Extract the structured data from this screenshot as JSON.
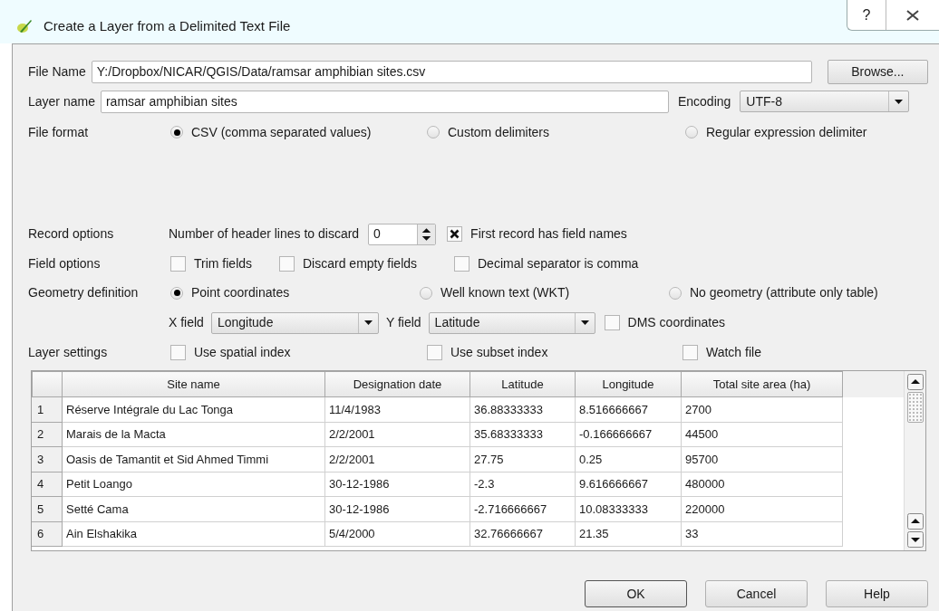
{
  "window": {
    "title": "Create a Layer from a Delimited Text File",
    "help_button": "?"
  },
  "file_name": {
    "label": "File Name",
    "value": "Y:/Dropbox/NICAR/QGIS/Data/ramsar amphibian sites.csv",
    "browse": "Browse..."
  },
  "layer_name": {
    "label": "Layer name",
    "value": "ramsar amphibian sites"
  },
  "encoding": {
    "label": "Encoding",
    "value": "UTF-8"
  },
  "file_format": {
    "label": "File format",
    "options": [
      {
        "label": "CSV (comma separated values)",
        "selected": true
      },
      {
        "label": "Custom delimiters",
        "selected": false
      },
      {
        "label": "Regular expression delimiter",
        "selected": false
      }
    ]
  },
  "record_options": {
    "label": "Record options",
    "header_lines_label": "Number of header lines to discard",
    "header_lines": "0",
    "first_record": {
      "label": "First record has field names",
      "checked": true
    }
  },
  "field_options": {
    "label": "Field options",
    "options": [
      {
        "label": "Trim fields",
        "checked": false
      },
      {
        "label": "Discard empty fields",
        "checked": false
      },
      {
        "label": "Decimal separator is comma",
        "checked": false
      }
    ]
  },
  "geometry": {
    "label": "Geometry definition",
    "options": [
      {
        "label": "Point coordinates",
        "selected": true
      },
      {
        "label": "Well known text (WKT)",
        "selected": false
      },
      {
        "label": "No geometry (attribute only table)",
        "selected": false
      }
    ],
    "x_label": "X field",
    "x_value": "Longitude",
    "y_label": "Y field",
    "y_value": "Latitude",
    "dms": {
      "label": "DMS coordinates",
      "checked": false
    }
  },
  "layer_settings": {
    "label": "Layer settings",
    "options": [
      {
        "label": "Use spatial index",
        "checked": false
      },
      {
        "label": "Use subset index",
        "checked": false
      },
      {
        "label": "Watch file",
        "checked": false
      }
    ]
  },
  "table": {
    "columns": [
      "Site name",
      "Designation date",
      "Latitude",
      "Longitude",
      "Total site area (ha)"
    ],
    "rows": [
      {
        "index": "1",
        "cells": [
          "Réserve Intégrale du Lac Tonga",
          "11/4/1983",
          "36.88333333",
          "8.516666667",
          "2700"
        ]
      },
      {
        "index": "2",
        "cells": [
          "Marais de la Macta",
          "2/2/2001",
          "35.68333333",
          "-0.166666667",
          "44500"
        ]
      },
      {
        "index": "3",
        "cells": [
          "Oasis de Tamantit et Sid Ahmed Timmi",
          "2/2/2001",
          "27.75",
          "0.25",
          "95700"
        ]
      },
      {
        "index": "4",
        "cells": [
          "Petit Loango",
          "30-12-1986",
          "-2.3",
          "9.616666667",
          "480000"
        ]
      },
      {
        "index": "5",
        "cells": [
          "Setté Cama",
          "30-12-1986",
          "-2.716666667",
          "10.08333333",
          "220000"
        ]
      },
      {
        "index": "6",
        "cells": [
          "Ain Elshakika",
          "5/4/2000",
          "32.76666667",
          "21.35",
          "33"
        ]
      }
    ]
  },
  "buttons": [
    "OK",
    "Cancel",
    "Help"
  ]
}
